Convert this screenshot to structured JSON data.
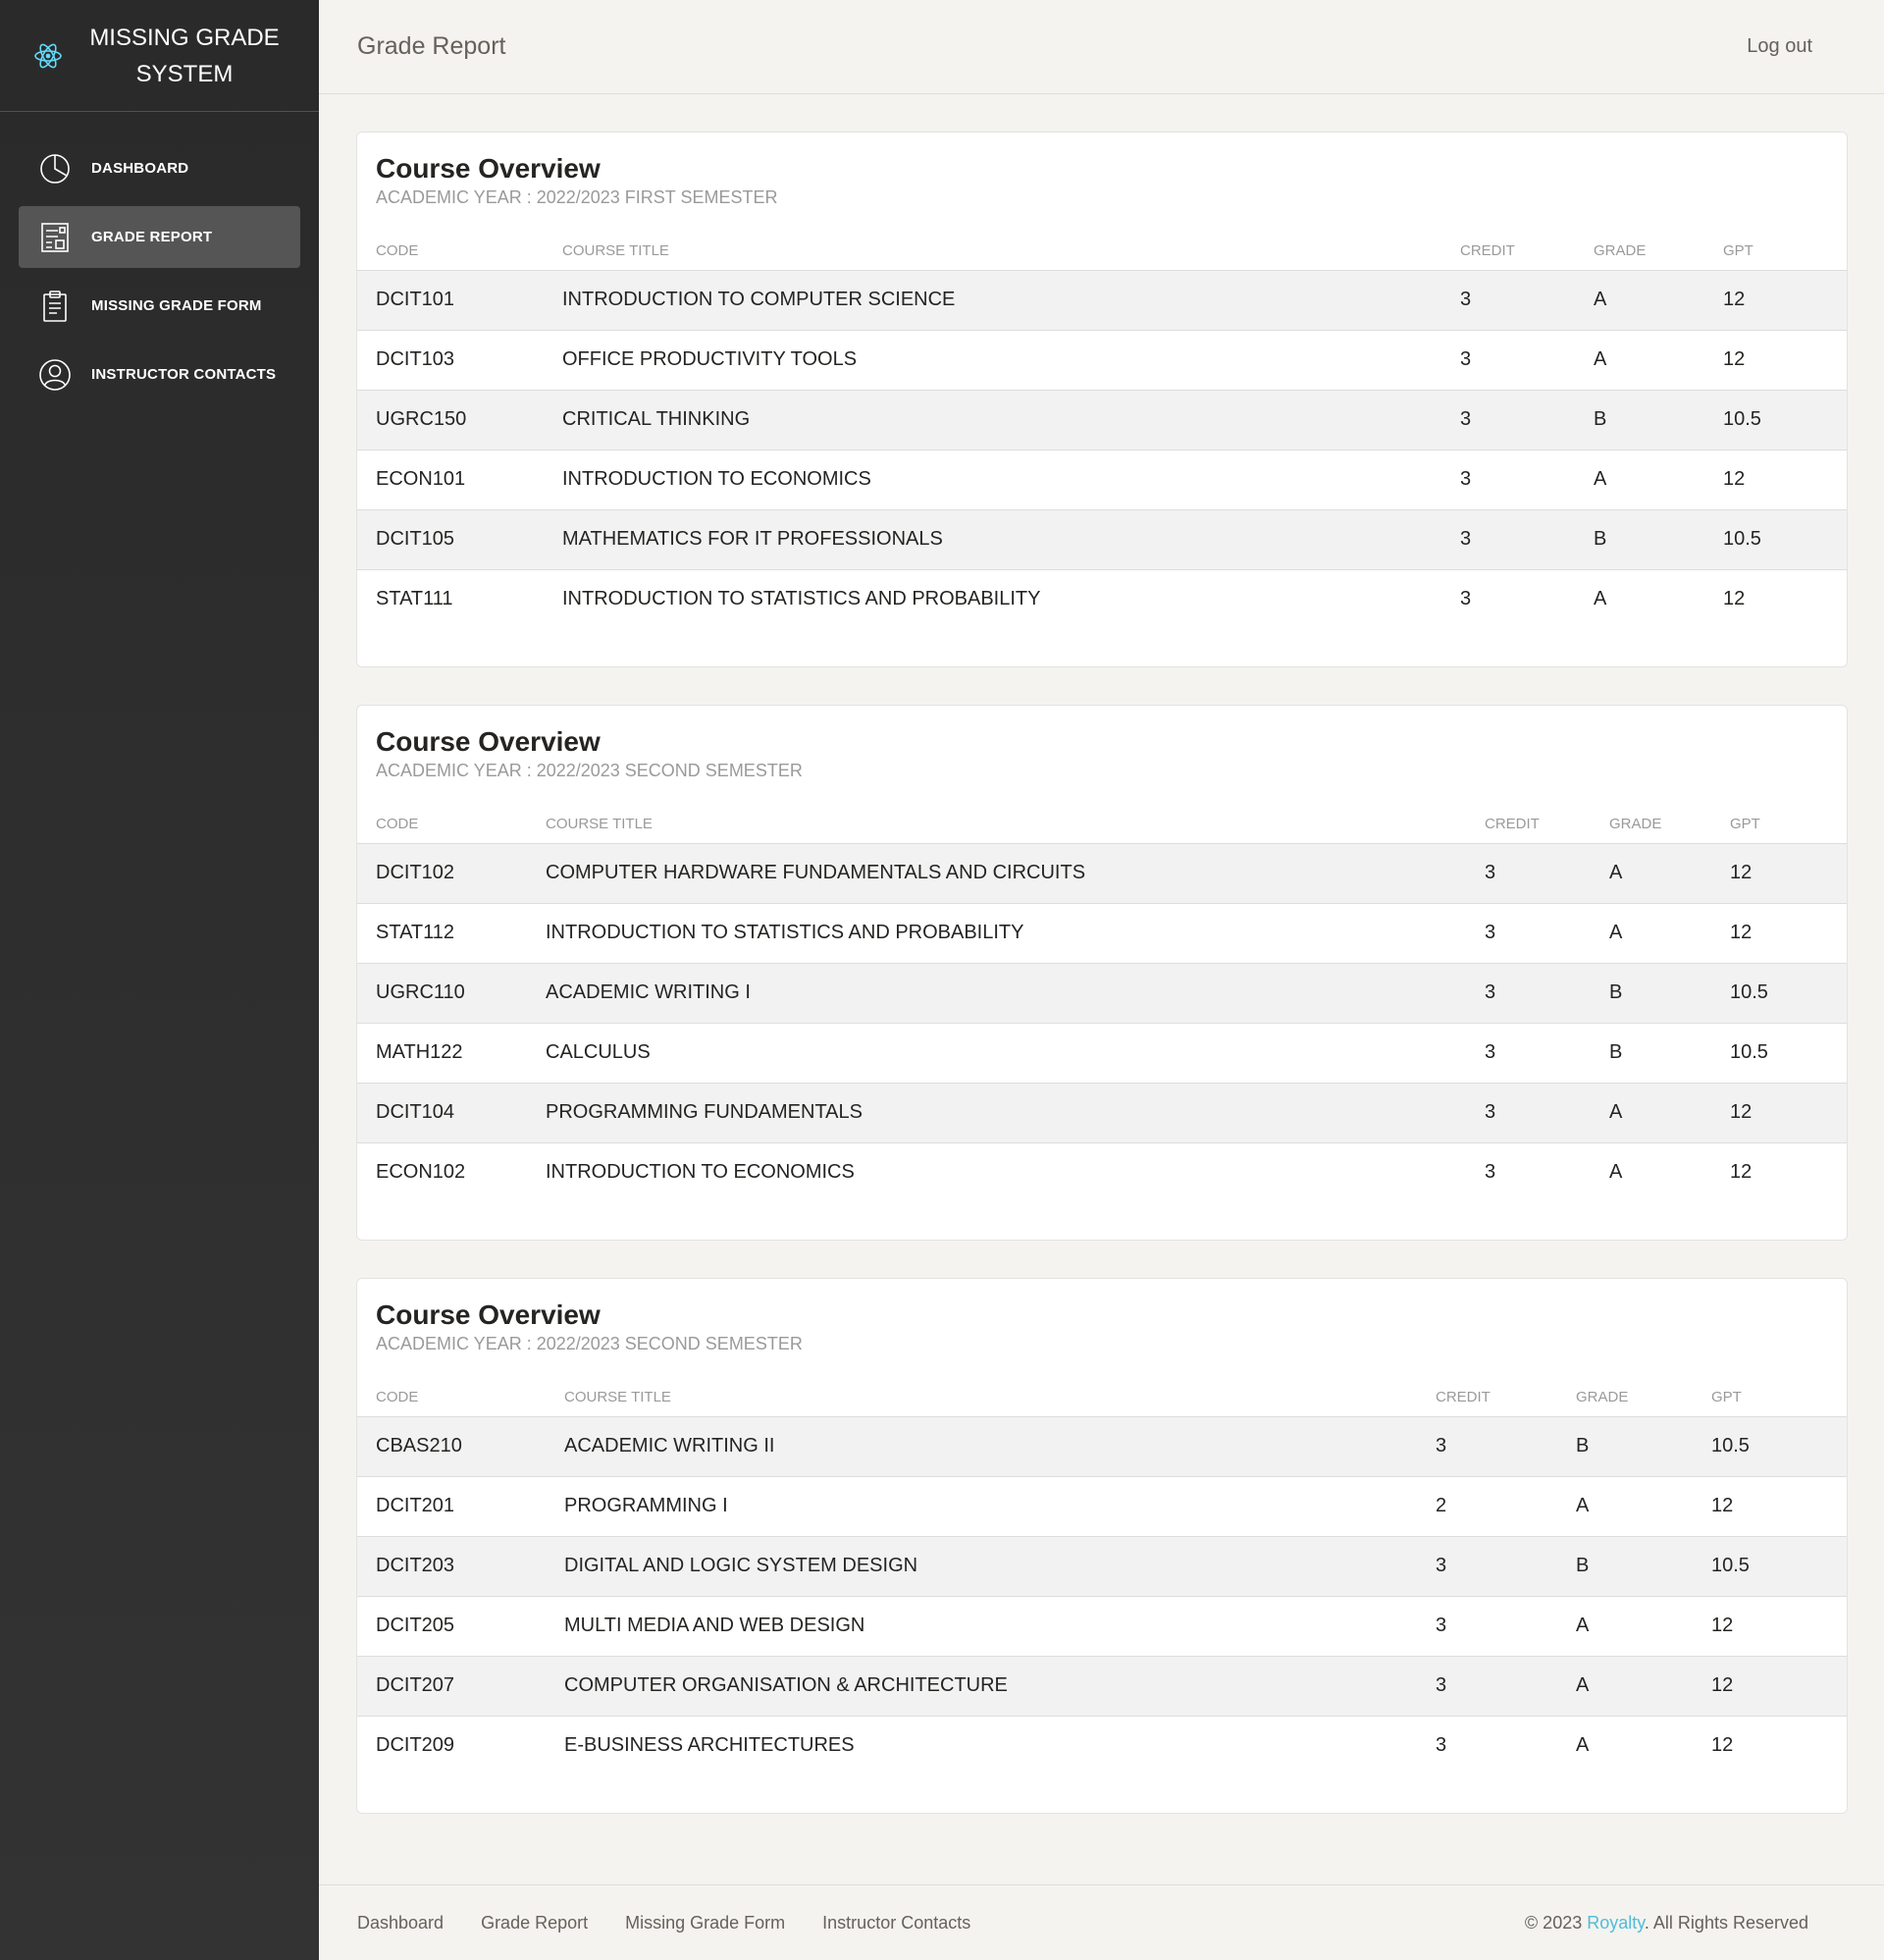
{
  "brand": {
    "title": "MISSING GRADE SYSTEM",
    "logo_icon": "react-atom-icon",
    "logo_color": "#61dafb"
  },
  "sidebar": {
    "items": [
      {
        "label": "DASHBOARD",
        "icon": "pie-chart-icon"
      },
      {
        "label": "GRADE REPORT",
        "icon": "report-icon",
        "active": true
      },
      {
        "label": "MISSING GRADE FORM",
        "icon": "clipboard-icon"
      },
      {
        "label": "INSTRUCTOR CONTACTS",
        "icon": "user-circle-icon"
      }
    ]
  },
  "topbar": {
    "title": "Grade Report",
    "logout": "Log out"
  },
  "columns": [
    "CODE",
    "COURSE TITLE",
    "CREDIT",
    "GRADE",
    "GPT"
  ],
  "cards": [
    {
      "title": "Course Overview",
      "subtitle": "ACADEMIC YEAR : 2022/2023 FIRST SEMESTER",
      "rows": [
        [
          "DCIT101",
          "INTRODUCTION TO COMPUTER SCIENCE",
          "3",
          "A",
          "12"
        ],
        [
          "DCIT103",
          "OFFICE PRODUCTIVITY TOOLS",
          "3",
          "A",
          "12"
        ],
        [
          "UGRC150",
          "CRITICAL THINKING",
          "3",
          "B",
          "10.5"
        ],
        [
          "ECON101",
          "INTRODUCTION TO ECONOMICS",
          "3",
          "A",
          "12"
        ],
        [
          "DCIT105",
          "MATHEMATICS FOR IT PROFESSIONALS",
          "3",
          "B",
          "10.5"
        ],
        [
          "STAT111",
          "INTRODUCTION TO STATISTICS AND PROBABILITY",
          "3",
          "A",
          "12"
        ]
      ]
    },
    {
      "title": "Course Overview",
      "subtitle": "ACADEMIC YEAR : 2022/2023 SECOND SEMESTER",
      "rows": [
        [
          "DCIT102",
          "COMPUTER HARDWARE FUNDAMENTALS AND CIRCUITS",
          "3",
          "A",
          "12"
        ],
        [
          "STAT112",
          "INTRODUCTION TO STATISTICS AND PROBABILITY",
          "3",
          "A",
          "12"
        ],
        [
          "UGRC110",
          "ACADEMIC WRITING I",
          "3",
          "B",
          "10.5"
        ],
        [
          "MATH122",
          "CALCULUS",
          "3",
          "B",
          "10.5"
        ],
        [
          "DCIT104",
          "PROGRAMMING FUNDAMENTALS",
          "3",
          "A",
          "12"
        ],
        [
          "ECON102",
          "INTRODUCTION TO ECONOMICS",
          "3",
          "A",
          "12"
        ]
      ]
    },
    {
      "title": "Course Overview",
      "subtitle": "ACADEMIC YEAR : 2022/2023 SECOND SEMESTER",
      "rows": [
        [
          "CBAS210",
          "ACADEMIC WRITING II",
          "3",
          "B",
          "10.5"
        ],
        [
          "DCIT201",
          "PROGRAMMING I",
          "2",
          "A",
          "12"
        ],
        [
          "DCIT203",
          "DIGITAL AND LOGIC SYSTEM DESIGN",
          "3",
          "B",
          "10.5"
        ],
        [
          "DCIT205",
          "MULTI MEDIA AND WEB DESIGN",
          "3",
          "A",
          "12"
        ],
        [
          "DCIT207",
          "COMPUTER ORGANISATION & ARCHITECTURE",
          "3",
          "A",
          "12"
        ],
        [
          "DCIT209",
          "E-BUSINESS ARCHITECTURES",
          "3",
          "A",
          "12"
        ]
      ]
    }
  ],
  "footer": {
    "links": [
      "Dashboard",
      "Grade Report",
      "Missing Grade Form",
      "Instructor Contacts"
    ],
    "copyright_prefix": "© 2023 ",
    "copyright_link": "Royalty",
    "copyright_suffix": ". All Rights Reserved",
    "link_color": "#51bcda"
  }
}
